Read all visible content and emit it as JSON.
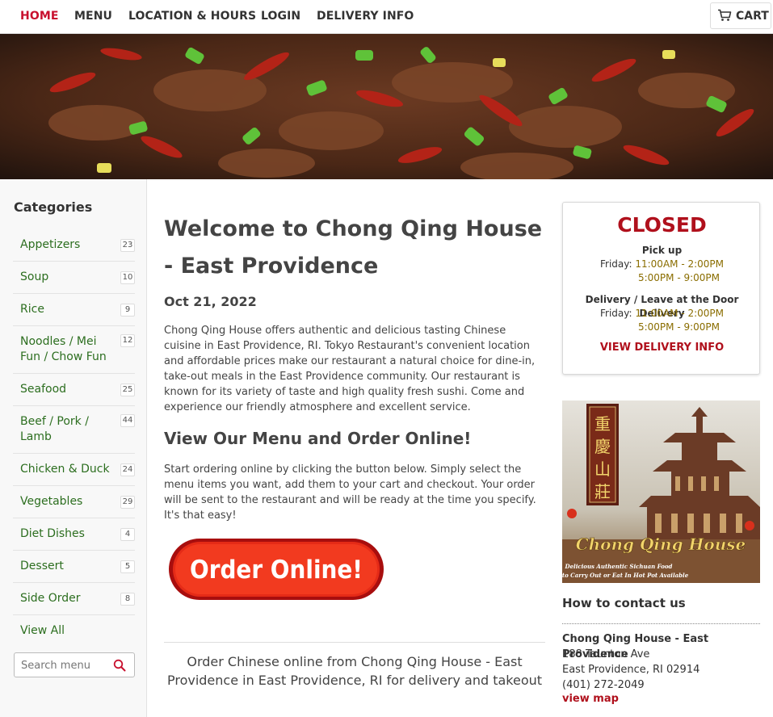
{
  "nav": {
    "items": [
      "HOME",
      "MENU",
      "LOCATION & HOURS",
      "LOGIN",
      "DELIVERY INFO"
    ],
    "cart_label": "CART"
  },
  "sidebar": {
    "title": "Categories",
    "categories": [
      {
        "name": "Appetizers",
        "count": "23"
      },
      {
        "name": "Soup",
        "count": "10"
      },
      {
        "name": "Rice",
        "count": "9"
      },
      {
        "name": "Noodles / Mei Fun / Chow Fun",
        "count": "12"
      },
      {
        "name": "Seafood",
        "count": "25"
      },
      {
        "name": "Beef / Pork / Lamb",
        "count": "44"
      },
      {
        "name": "Chicken & Duck",
        "count": "24"
      },
      {
        "name": "Vegetables",
        "count": "29"
      },
      {
        "name": "Diet Dishes",
        "count": "4"
      },
      {
        "name": "Dessert",
        "count": "5"
      },
      {
        "name": "Side Order",
        "count": "8"
      }
    ],
    "view_all": "View All",
    "search_placeholder": "Search menu"
  },
  "main": {
    "title": "Welcome to Chong Qing House - East Providence",
    "date": "Oct 21, 2022",
    "intro": "Chong Qing House offers authentic and delicious tasting Chinese cuisine in East Providence, RI. Tokyo Restaurant's convenient location and affordable prices make our restaurant a natural choice for dine-in, take-out meals in the East Providence community. Our restaurant is known for its variety of taste and high quality fresh sushi. Come and experience our friendly atmosphere and excellent service.",
    "menu_heading": "View Our Menu and Order Online!",
    "menu_text": "Start ordering online by clicking the button below. Simply select the menu items you want, add them to your cart and checkout. Your order will be sent to the restaurant and will be ready at the time you specify. It's that easy!",
    "order_button": "Order Online!",
    "footer": "Order Chinese online from Chong Qing House - East Providence in East Providence, RI for delivery and takeout"
  },
  "status": {
    "state": "CLOSED",
    "pickup_label": "Pick up",
    "pickup_day": "Friday: ",
    "pickup_hours_1": "11:00AM - 2:00PM",
    "pickup_hours_2": "5:00PM - 9:00PM",
    "delivery_label": "Delivery / Leave at the Door Delivery",
    "delivery_day": "Friday: ",
    "delivery_hours_1": "11:00AM - 2:00PM",
    "delivery_hours_2": "5:00PM - 9:00PM",
    "delivery_link": "VIEW DELIVERY INFO"
  },
  "promo": {
    "sign_text": "重慶山莊",
    "brand": "Chong Qing House",
    "tagline_1": "Delicious Authentic Sichuan Food",
    "tagline_2": "to Carry Out or Eat In Hot Pot Available"
  },
  "contact": {
    "heading": "How to contact us",
    "name": "Chong Qing House - East Providence",
    "address_1": "188 Taunton Ave",
    "address_2": "East Providence, RI 02914",
    "phone": "(401) 272-2049",
    "map_link": "view map"
  },
  "colors": {
    "accent_red": "#c8102e",
    "category_green": "#2c6e1f",
    "hours_gold": "#8a6d00"
  }
}
